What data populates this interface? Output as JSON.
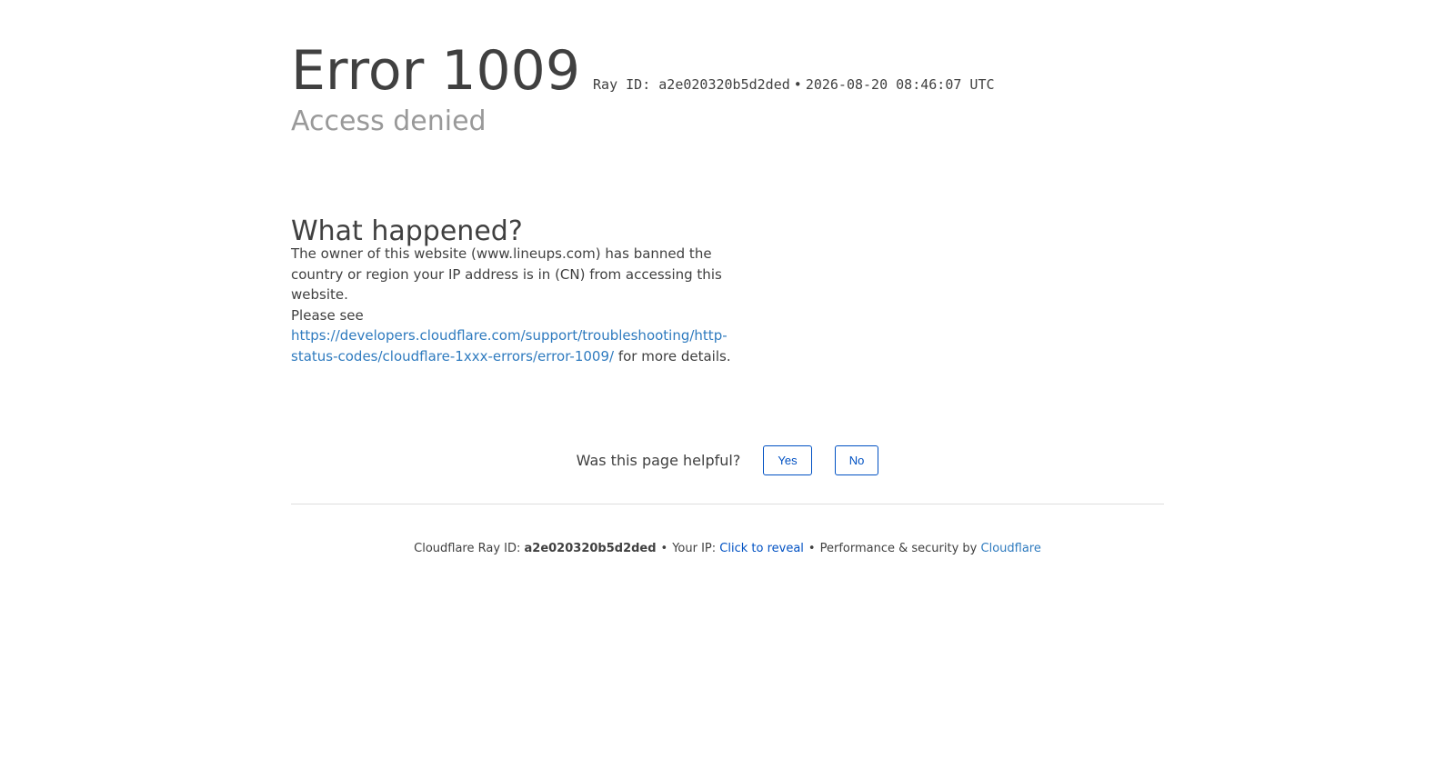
{
  "header": {
    "error_title": "Error 1009",
    "ray_id_label": "Ray ID: a2e020320b5d2ded",
    "separator": "•",
    "timestamp": "2026-08-20 08:46:07 UTC",
    "subtitle": "Access denied"
  },
  "what_happened": {
    "heading": "What happened?",
    "paragraph": "The owner of this website (www.lineups.com) has banned the country or region your IP address is in (CN) from accessing this website.",
    "see_prefix": "Please see",
    "link_text": "https://developers.cloudflare.com/support/troubleshooting/http-status-codes/cloudflare-1xxx-errors/error-1009/",
    "see_suffix": " for more details."
  },
  "feedback": {
    "question": "Was this page helpful?",
    "yes_label": "Yes",
    "no_label": "No"
  },
  "footer": {
    "ray_label": "Cloudflare Ray ID: ",
    "ray_value": "a2e020320b5d2ded",
    "bullet": "•",
    "ip_label": "Your IP: ",
    "reveal_link": "Click to reveal",
    "perf_label": "Performance & security by ",
    "brand_link": "Cloudflare"
  },
  "colors": {
    "text": "#404040",
    "muted": "#999999",
    "link": "#2f7bbf",
    "button_accent": "#0051c3",
    "divider": "#dedede"
  }
}
